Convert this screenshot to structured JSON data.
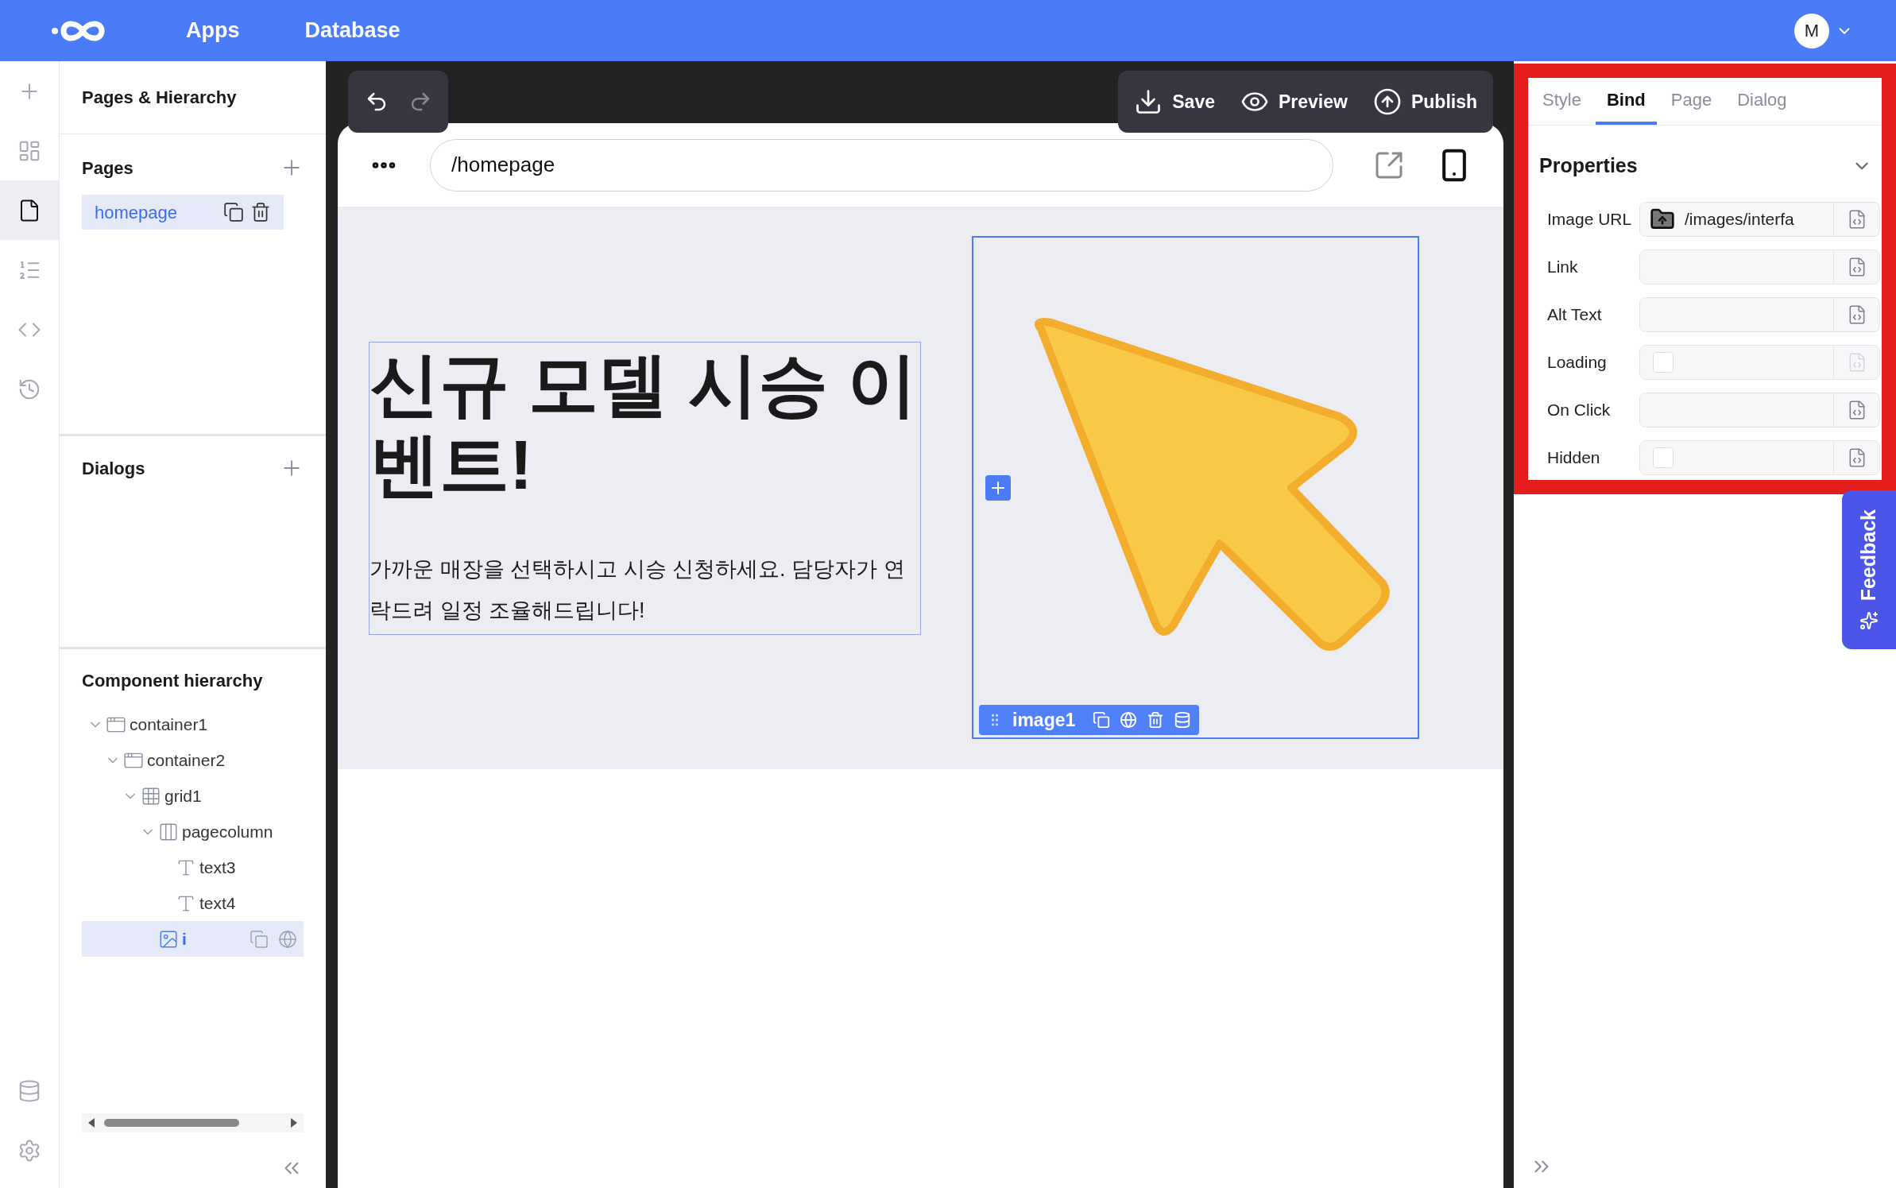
{
  "topbar": {
    "nav": [
      {
        "label": "Apps"
      },
      {
        "label": "Database"
      }
    ],
    "avatar": "M"
  },
  "rail": {
    "top": [
      {
        "kind": "plus",
        "selected": false
      },
      {
        "kind": "layout",
        "selected": false
      },
      {
        "kind": "page",
        "selected": true
      },
      {
        "kind": "list",
        "selected": false
      },
      {
        "kind": "code",
        "selected": false
      },
      {
        "kind": "history",
        "selected": false
      }
    ],
    "bottom": [
      {
        "kind": "database",
        "selected": false
      },
      {
        "kind": "settings",
        "selected": false
      }
    ]
  },
  "left_panel": {
    "title": "Pages & Hierarchy",
    "pages": {
      "heading": "Pages",
      "items": [
        {
          "label": "homepage",
          "selected": true
        }
      ]
    },
    "dialogs": {
      "heading": "Dialogs"
    },
    "hierarchy": {
      "heading": "Component hierarchy",
      "tree": [
        {
          "label": "container1",
          "kind": "container",
          "expanded": true,
          "selected": false,
          "children": [
            {
              "label": "container2",
              "kind": "container",
              "expanded": true,
              "selected": false,
              "children": [
                {
                  "label": "grid1",
                  "kind": "grid",
                  "expanded": true,
                  "selected": false,
                  "children": [
                    {
                      "label": "pagecolumn",
                      "kind": "column",
                      "expanded": true,
                      "selected": false,
                      "children": [
                        {
                          "label": "text3",
                          "kind": "text",
                          "selected": false
                        },
                        {
                          "label": "text4",
                          "kind": "text",
                          "selected": false
                        }
                      ]
                    },
                    {
                      "label": "i",
                      "kind": "image",
                      "selected": true
                    }
                  ]
                }
              ]
            }
          ]
        }
      ]
    }
  },
  "canvas": {
    "actions": [
      {
        "label": "Save",
        "kind": "save"
      },
      {
        "label": "Preview",
        "kind": "preview"
      },
      {
        "label": "Publish",
        "kind": "publish"
      }
    ],
    "url": "/homepage",
    "heading": "신규 모델 시승 이벤트!",
    "paragraph": "가까운 매장을 선택하시고 시승 신청하세요. 담당자가 연락드려 일정 조율해드립니다!",
    "image_label": "image1"
  },
  "properties_panel": {
    "tabs": [
      {
        "label": "Style",
        "selected": false
      },
      {
        "label": "Bind",
        "selected": true
      },
      {
        "label": "Page",
        "selected": false
      },
      {
        "label": "Dialog",
        "selected": false
      }
    ],
    "section": "Properties",
    "expanded": true,
    "fields": [
      {
        "label": "Image URL",
        "kind": "file",
        "value": "/images/interfa",
        "disabled": false
      },
      {
        "label": "Link",
        "kind": "text",
        "disabled": false
      },
      {
        "label": "Alt Text",
        "kind": "text",
        "disabled": false
      },
      {
        "label": "Loading",
        "kind": "checkbox",
        "checked": false,
        "disabled": true
      },
      {
        "label": "On Click",
        "kind": "text",
        "disabled": false
      },
      {
        "label": "Hidden",
        "kind": "checkbox",
        "checked": false,
        "disabled": false
      }
    ]
  },
  "feedback": "Feedback"
}
